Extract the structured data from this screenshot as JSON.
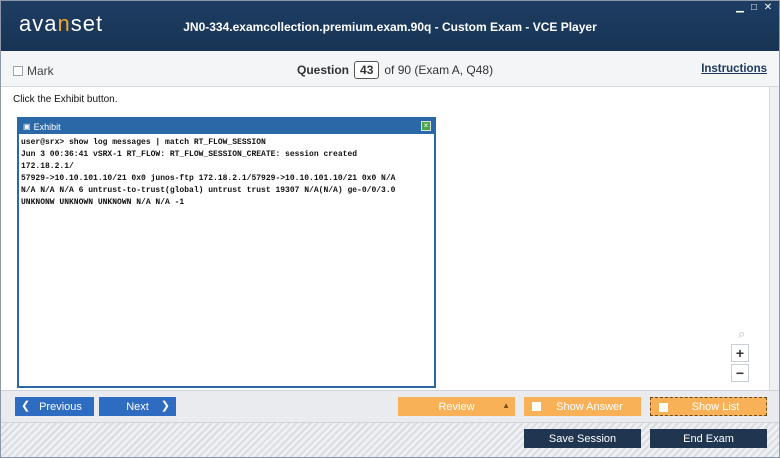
{
  "window": {
    "logo": "avanset",
    "title": "JN0-334.examcollection.premium.exam.90q - Custom Exam - VCE Player"
  },
  "question_bar": {
    "mark_label": "Mark",
    "question_label": "Question",
    "question_number": "43",
    "question_of": "of 90 (Exam A, Q48)",
    "instructions_label": "Instructions"
  },
  "content": {
    "prompt": "Click the Exhibit button.",
    "exhibit_title": "Exhibit",
    "exhibit_text": "user@srx> show log messages | match RT_FLOW_SESSION\nJun 3 00:36:41 vSRX-1 RT_FLOW: RT_FLOW_SESSION_CREATE: session created\n172.18.2.1/\n57929->10.10.101.10/21 0x0 junos-ftp 172.18.2.1/57929->10.10.101.10/21 0x0 N/A\nN/A N/A N/A 6 untrust-to-trust(global) untrust trust 19307 N/A(N/A) ge-0/0/3.0\nUNKNONW UNKNOWN UNKNOWN N/A N/A -1"
  },
  "zoom": {
    "in_label": "+",
    "out_label": "−"
  },
  "nav": {
    "previous_label": "Previous",
    "next_label": "Next",
    "review_label": "Review",
    "show_answer_label": "Show Answer",
    "show_list_label": "Show List"
  },
  "footer": {
    "save_session_label": "Save Session",
    "end_exam_label": "End Exam"
  },
  "colors": {
    "titlebar": "#1e3d63",
    "logo_accent": "#f6a623",
    "nav_blue": "#2d6cc0",
    "orange": "#f9b157",
    "dark_button": "#1f3550",
    "exhibit_border": "#2a68a8"
  }
}
